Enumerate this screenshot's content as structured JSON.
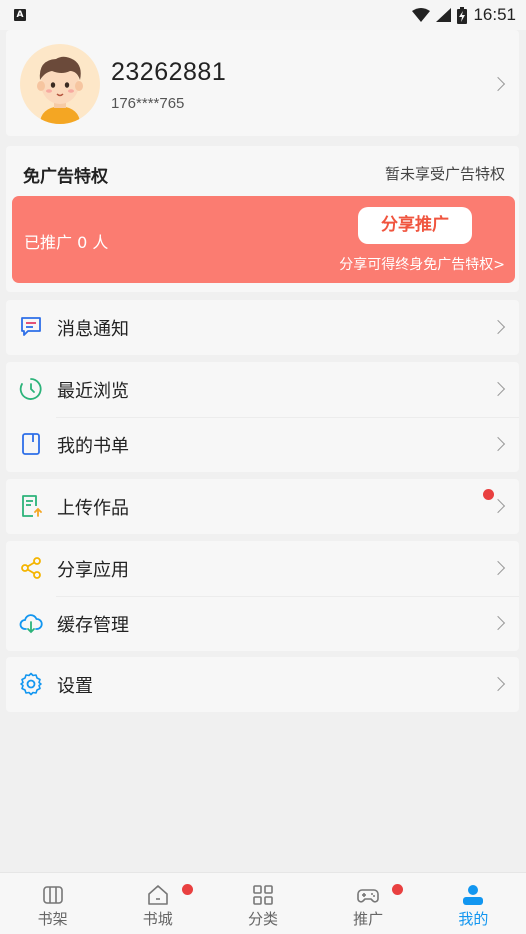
{
  "status_bar": {
    "time": "16:51",
    "notification_icon": "A"
  },
  "profile": {
    "name": "23262881",
    "phone": "176****765"
  },
  "ad_free": {
    "title": "免广告特权",
    "status": "暂未享受广告特权",
    "promoted_count": "已推广 0 人",
    "share_button": "分享推广",
    "share_hint": "分享可得终身免广告特权>"
  },
  "menu": {
    "notifications": "消息通知",
    "recent": "最近浏览",
    "booklist": "我的书单",
    "upload": "上传作品",
    "share_app": "分享应用",
    "cache": "缓存管理",
    "settings": "设置"
  },
  "tabs": [
    {
      "label": "书架",
      "icon": "bookshelf-icon"
    },
    {
      "label": "书城",
      "icon": "home-icon"
    },
    {
      "label": "分类",
      "icon": "grid-icon"
    },
    {
      "label": "推广",
      "icon": "gamepad-icon"
    },
    {
      "label": "我的",
      "icon": "person-icon"
    }
  ],
  "colors": {
    "accent": "#1296f0",
    "promo_bg": "#fb7c71",
    "badge": "#e94040"
  }
}
